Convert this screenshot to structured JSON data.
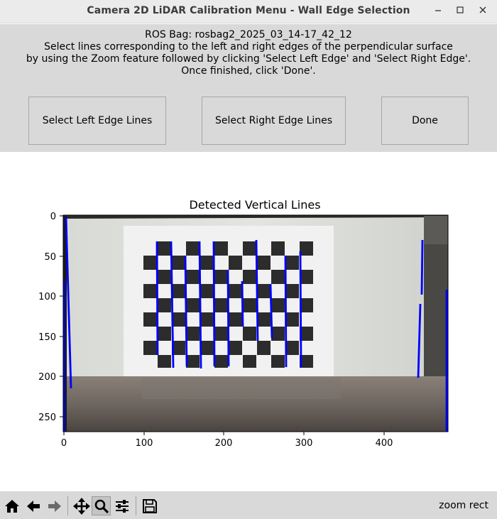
{
  "window": {
    "title": "Camera 2D LiDAR Calibration Menu - Wall Edge Selection",
    "controls": {
      "minimize": "–",
      "maximize": "□",
      "close": "✕"
    }
  },
  "instructions": [
    "ROS Bag: rosbag2_2025_03_14-17_42_12",
    "Select lines corresponding to the left and right edges of the perpendicular surface",
    "by using the Zoom feature followed by clicking 'Select Left Edge' and 'Select Right Edge'.",
    "Once finished, click 'Done'."
  ],
  "buttons": {
    "left_edge": "Select Left Edge Lines",
    "right_edge": "Select Right Edge Lines",
    "done": "Done"
  },
  "plot": {
    "title": "Detected Vertical Lines",
    "x_ticks": [
      "0",
      "100",
      "200",
      "300",
      "400"
    ],
    "y_ticks": [
      "0",
      "50",
      "100",
      "150",
      "200",
      "250"
    ],
    "line_color": "#0000ff"
  },
  "toolbar": {
    "icons": [
      "home-icon",
      "back-icon",
      "forward-icon",
      "pan-icon",
      "zoom-icon",
      "configure-subplots-icon",
      "save-icon"
    ],
    "status": "zoom rect"
  },
  "colors": {
    "panel_bg": "#d9d9d9",
    "titlebar_bg": "#ebebeb",
    "line": "#0000ff"
  }
}
